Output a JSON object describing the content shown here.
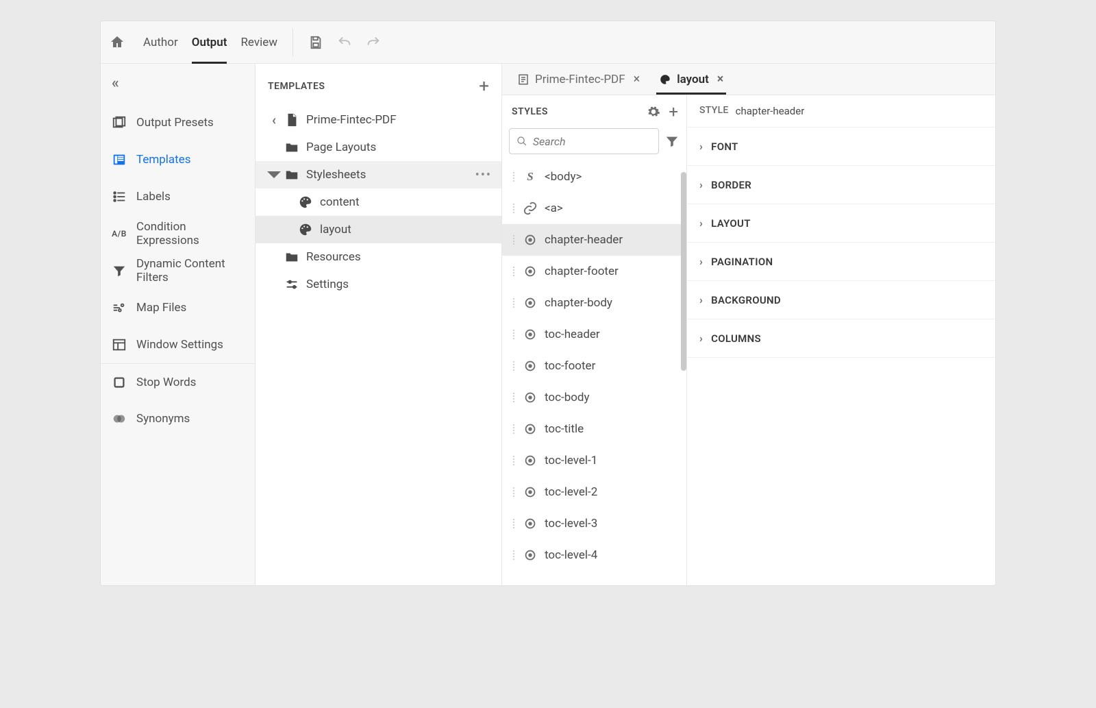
{
  "topbar": {
    "tabs": [
      "Author",
      "Output",
      "Review"
    ],
    "active_tab": "Output"
  },
  "sidebar": {
    "items": [
      {
        "id": "output-presets",
        "label": "Output Presets"
      },
      {
        "id": "templates",
        "label": "Templates"
      },
      {
        "id": "labels",
        "label": "Labels"
      },
      {
        "id": "condition-expressions",
        "label": "Condition Expressions"
      },
      {
        "id": "dynamic-content-filters",
        "label": "Dynamic Content Filters"
      },
      {
        "id": "map-files",
        "label": "Map Files"
      },
      {
        "id": "window-settings",
        "label": "Window Settings"
      },
      {
        "id": "stop-words",
        "label": "Stop Words"
      },
      {
        "id": "synonyms",
        "label": "Synonyms"
      }
    ],
    "active_id": "templates"
  },
  "templates_panel": {
    "title": "TEMPLATES",
    "back_label": "Prime-Fintec-PDF",
    "tree": [
      {
        "label": "Page Layouts",
        "icon": "folder",
        "expanded": false,
        "depth": 1
      },
      {
        "label": "Stylesheets",
        "icon": "folder",
        "expanded": true,
        "more": true,
        "hover": true,
        "depth": 1,
        "children": [
          {
            "label": "content",
            "icon": "palette",
            "depth": 2
          },
          {
            "label": "layout",
            "icon": "palette",
            "depth": 2,
            "selected": true
          }
        ]
      },
      {
        "label": "Resources",
        "icon": "folder",
        "expanded": false,
        "depth": 1
      },
      {
        "label": "Settings",
        "icon": "sliders",
        "depth": 1
      }
    ]
  },
  "editor_tabs": [
    {
      "label": "Prime-Fintec-PDF",
      "icon": "page",
      "closable": true,
      "active": false
    },
    {
      "label": "layout",
      "icon": "palette",
      "closable": true,
      "active": true
    }
  ],
  "styles": {
    "title": "STYLES",
    "search_placeholder": "Search",
    "list": [
      {
        "name": "<body>",
        "type": "S",
        "selected": false
      },
      {
        "name": "<a>",
        "type": "link",
        "selected": false
      },
      {
        "name": "chapter-header",
        "type": "target",
        "selected": true
      },
      {
        "name": "chapter-footer",
        "type": "target",
        "selected": false
      },
      {
        "name": "chapter-body",
        "type": "target",
        "selected": false
      },
      {
        "name": "toc-header",
        "type": "target",
        "selected": false
      },
      {
        "name": "toc-footer",
        "type": "target",
        "selected": false
      },
      {
        "name": "toc-body",
        "type": "target",
        "selected": false
      },
      {
        "name": "toc-title",
        "type": "target",
        "selected": false
      },
      {
        "name": "toc-level-1",
        "type": "target",
        "selected": false
      },
      {
        "name": "toc-level-2",
        "type": "target",
        "selected": false
      },
      {
        "name": "toc-level-3",
        "type": "target",
        "selected": false
      },
      {
        "name": "toc-level-4",
        "type": "target",
        "selected": false
      }
    ]
  },
  "properties": {
    "header_label": "STYLE",
    "header_value": "chapter-header",
    "sections": [
      "FONT",
      "BORDER",
      "LAYOUT",
      "PAGINATION",
      "BACKGROUND",
      "COLUMNS"
    ]
  }
}
